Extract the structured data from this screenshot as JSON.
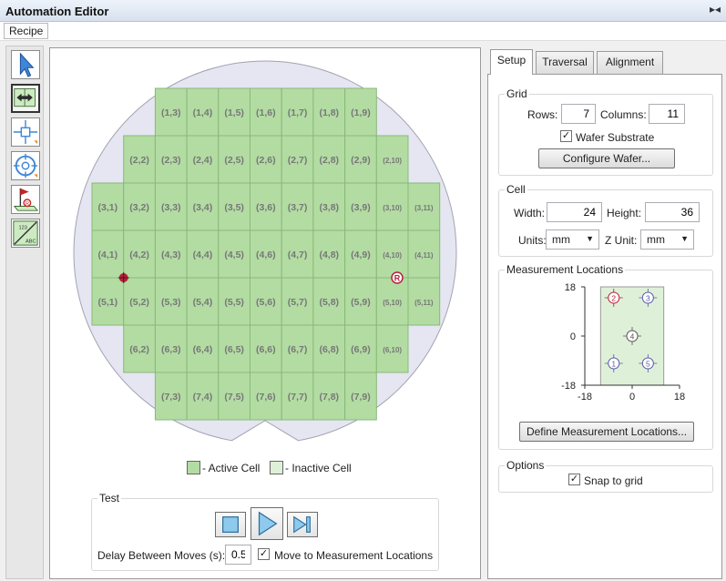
{
  "window": {
    "title": "Automation Editor",
    "pin_icon": "pin-icon"
  },
  "menu": {
    "recipe": "Recipe"
  },
  "tools": [
    {
      "name": "pointer-tool-icon"
    },
    {
      "name": "traverse-tool-icon"
    },
    {
      "name": "cell-select-tool-icon"
    },
    {
      "name": "alignment-target-tool-icon"
    },
    {
      "name": "reference-flag-tool-icon"
    },
    {
      "name": "label-tool-icon"
    }
  ],
  "wafer": {
    "rows": 7,
    "columns": 11,
    "first_row": 1,
    "row_ranges": [
      {
        "row": 1,
        "from": 3,
        "to": 9
      },
      {
        "row": 2,
        "from": 2,
        "to": 10
      },
      {
        "row": 3,
        "from": 1,
        "to": 11
      },
      {
        "row": 4,
        "from": 1,
        "to": 11
      },
      {
        "row": 5,
        "from": 1,
        "to": 11
      },
      {
        "row": 6,
        "from": 2,
        "to": 10
      },
      {
        "row": 7,
        "from": 3,
        "to": 9
      }
    ],
    "markers": {
      "reference_label": "R"
    },
    "colors": {
      "active": "#b3dca3",
      "active_border": "#88b879",
      "wafer_fill": "#e5e6f1",
      "wafer_border": "#a2a3b1",
      "marker": "#b5203a",
      "label": "#777777"
    }
  },
  "legend": {
    "active": "- Active Cell",
    "inactive": "- Inactive Cell",
    "inactive_color": "#dff0d8"
  },
  "test": {
    "title": "Test",
    "delay_label": "Delay Between Moves (s):",
    "delay_value": "0.5",
    "move_label": "Move to Measurement Locations",
    "move_checked": true
  },
  "tabs": [
    {
      "label": "Setup",
      "active": true
    },
    {
      "label": "Traversal",
      "active": false
    },
    {
      "label": "Alignment",
      "active": false
    }
  ],
  "grid": {
    "title": "Grid",
    "rows_label": "Rows:",
    "rows_value": "7",
    "columns_label": "Columns:",
    "columns_value": "11",
    "substrate_label": "Wafer Substrate",
    "substrate_checked": true,
    "configure_button": "Configure Wafer..."
  },
  "cell": {
    "title": "Cell",
    "width_label": "Width:",
    "width_value": "24",
    "height_label": "Height:",
    "height_value": "36",
    "units_label": "Units:",
    "units_value": "mm",
    "zunit_label": "Z Unit:",
    "zunit_value": "mm"
  },
  "measurement": {
    "title": "Measurement Locations",
    "axis": {
      "x_ticks": [
        "-18",
        "0",
        "18"
      ],
      "y_ticks": [
        "18",
        "0",
        "-18"
      ],
      "xlim": [
        -18,
        18
      ],
      "ylim": [
        -18,
        18
      ]
    },
    "cell_extent": {
      "x": [
        -12,
        12
      ],
      "y": [
        -18,
        18
      ]
    },
    "points": [
      {
        "label": "1",
        "x": -7,
        "y": -10,
        "color": "#5a5aa8"
      },
      {
        "label": "2",
        "x": -7,
        "y": 14,
        "color": "#b5203a"
      },
      {
        "label": "3",
        "x": 6,
        "y": 14,
        "color": "#5a5aa8"
      },
      {
        "label": "4",
        "x": 0,
        "y": 0,
        "color": "#555555"
      },
      {
        "label": "5",
        "x": 6,
        "y": -10,
        "color": "#5a5aa8"
      }
    ],
    "define_button": "Define Measurement Locations..."
  },
  "options": {
    "title": "Options",
    "snap_label": "Snap to grid",
    "snap_checked": true
  }
}
